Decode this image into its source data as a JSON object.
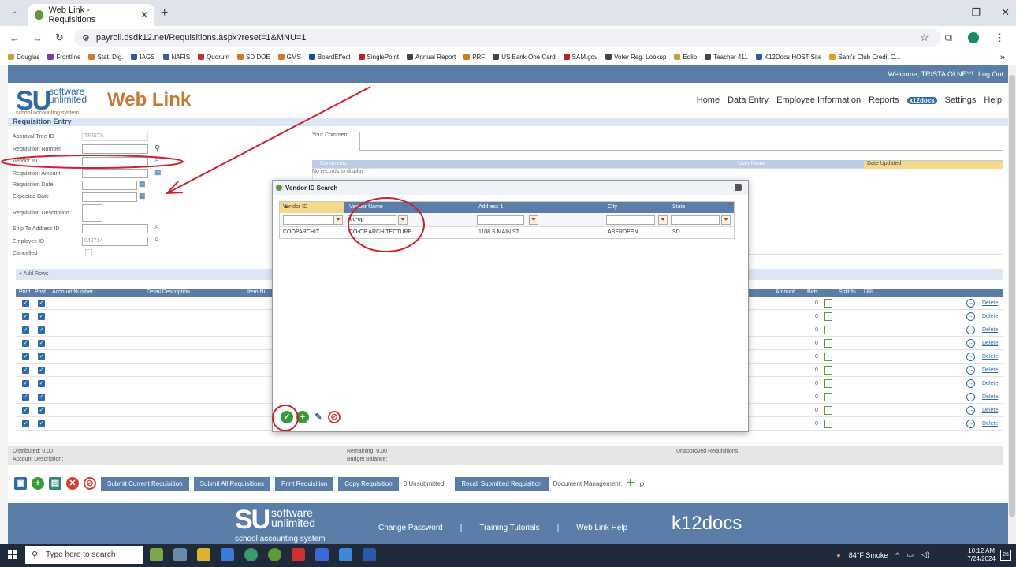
{
  "browser": {
    "tab_title": "Web Link - Requisitions",
    "url": "payroll.dsdk12.net/Requisitions.aspx?reset=1&MNU=1",
    "bookmarks": [
      "Douglas",
      "Frontline",
      "Stat. Dig.",
      "IAGS",
      "NAFIS",
      "Quorum",
      "SD DOE",
      "GMS",
      "BoardEffect",
      "SinglePoint",
      "Annual Report",
      "PRF",
      "US Bank One Card",
      "SAM.gov",
      "Voter Reg. Lookup",
      "Edlio",
      "Teacher 411",
      "K12Docs HOST Site",
      "Sam's Club Credit C..."
    ],
    "more": "»"
  },
  "app": {
    "welcome": "Welcome, TRISTA OLNEY!",
    "logout": "Log Out",
    "logo_su": "SU",
    "logo_software": "software",
    "logo_unlimited": "unlimited",
    "logo_tagline": "school accounting system",
    "product": "Web Link",
    "nav": [
      "Home",
      "Data Entry",
      "Employee Information",
      "Reports",
      "Settings",
      "Help"
    ],
    "k12": "k12docs"
  },
  "form": {
    "section": "Requisition Entry",
    "approval_tree_label": "Approval Tree ID",
    "approval_tree_value": "TRISTA",
    "req_number_label": "Requisition Number",
    "vendor_label": "Vendor ID",
    "amount_label": "Requisition Amount",
    "req_date_label": "Requisition Date",
    "exp_date_label": "Expected Date",
    "desc_label": "Requisition Description",
    "ship_label": "Ship To Address ID",
    "employee_label": "Employee ID",
    "employee_value": "042714",
    "cancelled_label": "Cancelled",
    "comment_label": "Your Comment"
  },
  "comments": {
    "col_comments": "Comments",
    "col_user": "User Name",
    "col_date": "Date Updated",
    "empty": "No records to display."
  },
  "lines": {
    "add_rows": "+ Add Rows",
    "headers": [
      "Print",
      "Post",
      "Account Number",
      "Detail Description",
      "Item Nu",
      "Amount",
      "Bids",
      "Split %",
      "URL"
    ],
    "bids_value": "0",
    "delete_label": "Delete",
    "row_count": 10
  },
  "totals": {
    "distributed": "Distributed: 0.00",
    "account_desc": "Account Description:",
    "remaining": "Remaining: 0.00",
    "budget": "Budget Balance:",
    "unapproved": "Unapproved Requisitions:"
  },
  "actions": {
    "submit_current": "Submit Current Requisition",
    "submit_all": "Submit All Requisitions",
    "print": "Print Requisition",
    "copy": "Copy Requisition",
    "unsubmitted": "0 Unsubmitted",
    "recall": "Recall Submitted Requisition",
    "doc_mgmt": "Document Management:"
  },
  "footer": {
    "links": [
      "Change Password",
      "|",
      "Training Tutorials",
      "|",
      "Web Link Help"
    ],
    "k12": "k12docs"
  },
  "modal": {
    "title": "Vendor ID Search",
    "headers": [
      "Vendor ID",
      "Vendor Name",
      "Address 1",
      "City",
      "State"
    ],
    "filter_vendor_name": "co-op",
    "row": {
      "vendor_id": "COOPARCHIT",
      "vendor_name": "CO-OP ARCHITECTURE",
      "address": "1108 S MAIN ST",
      "city": "ABERDEEN",
      "state": "SD"
    }
  },
  "taskbar": {
    "search": "Type here to search",
    "weather": "84°F Smoke",
    "time": "10:12 AM",
    "date": "7/24/2024",
    "notif": "26"
  },
  "colors": {
    "accent": "#5b7ea8",
    "annotation": "#d0202a",
    "brand_orange": "#c87832"
  }
}
